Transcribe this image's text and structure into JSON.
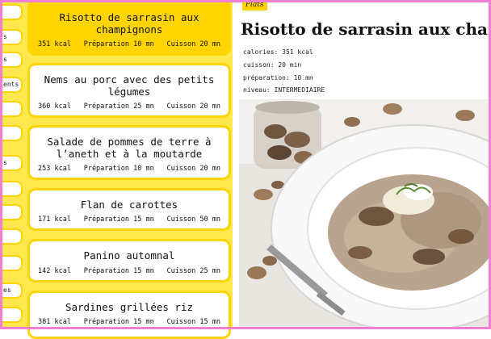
{
  "sidebar": {
    "items": [
      {
        "label": ""
      },
      {
        "label": "s"
      },
      {
        "label": "ents"
      },
      {
        "label": ""
      },
      {
        "label": ""
      },
      {
        "label": "s"
      },
      {
        "label": ""
      },
      {
        "label": ""
      },
      {
        "label": ""
      },
      {
        "label": ""
      },
      {
        "label": ""
      },
      {
        "label": "es"
      },
      {
        "label": ""
      }
    ]
  },
  "recipes": [
    {
      "title": "Risotto de sarrasin aux champignons",
      "kcal": "351 kcal",
      "prep": "Préparation 10 mn",
      "cook": "Cuisson 20 mn"
    },
    {
      "title": "Nems au porc avec des petits légumes",
      "kcal": "360 kcal",
      "prep": "Préparation 25 mn",
      "cook": "Cuisson 20 mn"
    },
    {
      "title": "Salade de pommes de terre à l’aneth et à la moutarde",
      "kcal": "253 kcal",
      "prep": "Préparation 10 mn",
      "cook": "Cuisson 20 mn"
    },
    {
      "title": "Flan de carottes",
      "kcal": "171 kcal",
      "prep": "Préparation 15 mn",
      "cook": "Cuisson 50 mn"
    },
    {
      "title": "Panino automnal",
      "kcal": "142 kcal",
      "prep": "Préparation 15 mn",
      "cook": "Cuisson 25 mn"
    },
    {
      "title": "Sardines grillées riz",
      "kcal": "381 kcal",
      "prep": "Préparation 15 mn",
      "cook": "Cuisson 15 mn"
    }
  ],
  "detail": {
    "category": "Plats",
    "title": "Risotto de sarrasin aux champignons",
    "calories": "calories: 351 kcal",
    "cuisson": "cuisson: 20 min",
    "preparation": "préparation: 10 mn",
    "niveau": "niveau: INTERMEDIAIRE"
  },
  "colors": {
    "accent": "#ffd400",
    "panel": "#ffe84d",
    "frame": "#f27fd6"
  }
}
